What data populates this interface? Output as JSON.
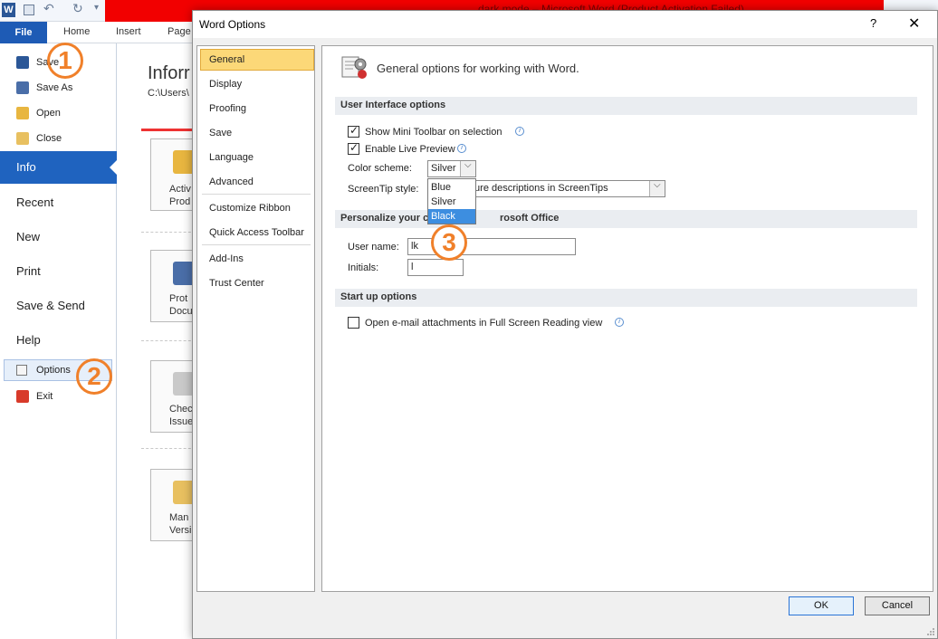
{
  "background_window": {
    "title": "dark mode – Microsoft Word (Product Activation Failed)",
    "tabs": [
      "Home",
      "Insert",
      "Page"
    ],
    "file_tab": "File",
    "app_icon_letter": "W"
  },
  "backstage": {
    "top_items": [
      "Save",
      "Save As",
      "Open",
      "Close"
    ],
    "selected": "Info",
    "big_items": [
      "Recent",
      "New",
      "Print",
      "Save & Send",
      "Help"
    ],
    "bottom_items": [
      "Options",
      "Exit"
    ],
    "info_heading": "Inforr",
    "info_path": "C:\\Users\\",
    "cards": [
      {
        "line1": "Activ",
        "line2": "Prod"
      },
      {
        "line1": "Prot",
        "line2": "Docum"
      },
      {
        "line1": "Check",
        "line2": "Issue"
      },
      {
        "line1": "Man",
        "line2": "Versi"
      }
    ]
  },
  "annotations": [
    "1",
    "2",
    "3"
  ],
  "dialog": {
    "title": "Word Options",
    "help": "?",
    "close": "✕",
    "nav": [
      "General",
      "Display",
      "Proofing",
      "Save",
      "Language",
      "Advanced",
      "Customize Ribbon",
      "Quick Access Toolbar",
      "Add-Ins",
      "Trust Center"
    ],
    "nav_selected": "General",
    "heading": "General options for working with Word.",
    "sections": {
      "ui": "User Interface options",
      "personalize": "Personalize your co",
      "personalize_tail": "rosoft Office",
      "startup": "Start up options"
    },
    "options": {
      "mini_toolbar": "Show Mini Toolbar on selection",
      "live_preview": "Enable Live Preview",
      "color_scheme_label": "Color scheme:",
      "color_scheme_value": "Silver",
      "color_scheme_options": [
        "Blue",
        "Silver",
        "Black"
      ],
      "color_scheme_highlighted": "Black",
      "screentip_label": "ScreenTip style:",
      "screentip_value": "ture descriptions in ScreenTips",
      "user_name_label": "User name:",
      "user_name_value": "lk",
      "initials_label": "Initials:",
      "initials_value": "l",
      "open_attachments": "Open e-mail attachments in Full Screen Reading view"
    },
    "buttons": {
      "ok": "OK",
      "cancel": "Cancel"
    }
  }
}
